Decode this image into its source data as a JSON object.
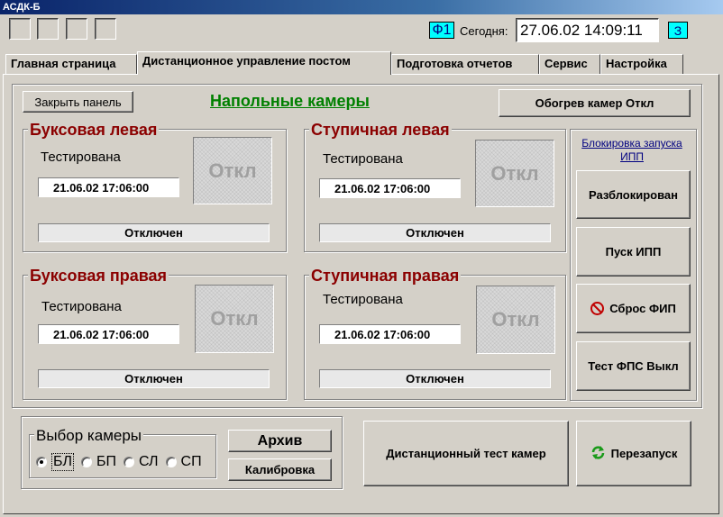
{
  "window": {
    "title": "АСДК-Б"
  },
  "header": {
    "f1_label": "Ф1",
    "today_label": "Сегодня:",
    "datetime": "27.06.02 14:09:11",
    "indicator": "З"
  },
  "tabs": [
    {
      "label": "Главная страница"
    },
    {
      "label": "Дистанционное управление постом"
    },
    {
      "label": "Подготовка отчетов"
    },
    {
      "label": "Сервис"
    },
    {
      "label": "Настройка"
    }
  ],
  "active_tab": "Дистанционное управление постом",
  "panel": {
    "close_label": "Закрыть панель",
    "title": "Напольные камеры",
    "heating_label": "Обогрев камер Откл"
  },
  "cameras": [
    {
      "title": "Буксовая левая",
      "status_text": "Тестирована",
      "date": "21.06.02  17:06:00",
      "state_label": "Откл",
      "connection": "Отключен"
    },
    {
      "title": "Ступичная левая",
      "status_text": "Тестирована",
      "date": "21.06.02  17:06:00",
      "state_label": "Откл",
      "connection": "Отключен"
    },
    {
      "title": "Буксовая правая",
      "status_text": "Тестирована",
      "date": "21.06.02  17:06:00",
      "state_label": "Откл",
      "connection": "Отключен"
    },
    {
      "title": "Ступичная правая",
      "status_text": "Тестирована",
      "date": "21.06.02  17:06:00",
      "state_label": "Откл",
      "connection": "Отключен"
    }
  ],
  "ipp": {
    "lock_label": "Блокировка запуска ИПП",
    "unlocked_label": "Разблокирован",
    "start_label": "Пуск ИПП",
    "reset_label": "Сброс ФИП",
    "test_label": "Тест ФПС Выкл"
  },
  "camera_select": {
    "title": "Выбор камеры",
    "options": [
      "БЛ",
      "БП",
      "СЛ",
      "СП"
    ],
    "selected": "БЛ"
  },
  "archive_label": "Архив",
  "calibration_label": "Калибровка",
  "remote_test_label": "Дистанционный тест камер",
  "restart_label": "Перезапуск",
  "colors": {
    "camera_title": "#8b0000",
    "panel_title": "#008000",
    "indicator_bg": "#00ffff"
  }
}
